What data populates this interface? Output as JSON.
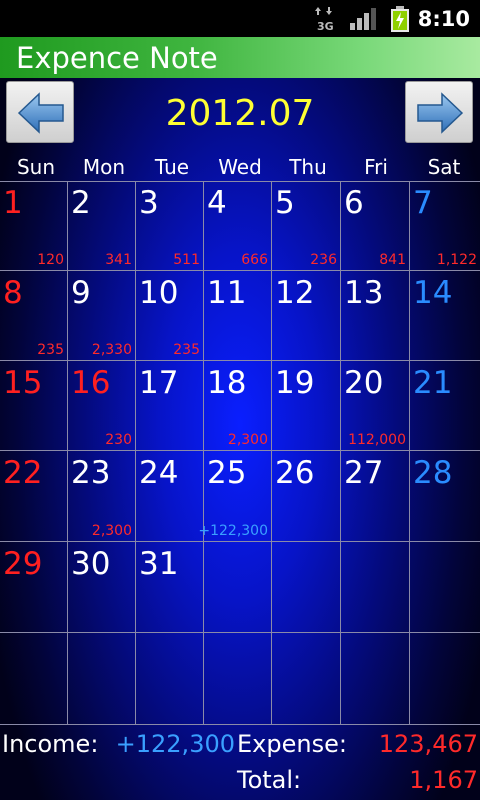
{
  "status_bar": {
    "network": "3G",
    "time": "8:10"
  },
  "app": {
    "title": "Expence Note"
  },
  "calendar": {
    "month": "2012.07",
    "weekdays": [
      "Sun",
      "Mon",
      "Tue",
      "Wed",
      "Thu",
      "Fri",
      "Sat"
    ],
    "rows": [
      [
        {
          "d": "1",
          "a": "120"
        },
        {
          "d": "2",
          "a": "341"
        },
        {
          "d": "3",
          "a": "511"
        },
        {
          "d": "4",
          "a": "666"
        },
        {
          "d": "5",
          "a": "236"
        },
        {
          "d": "6",
          "a": "841"
        },
        {
          "d": "7",
          "a": "1,122"
        }
      ],
      [
        {
          "d": "8",
          "a": "235"
        },
        {
          "d": "9",
          "a": "2,330"
        },
        {
          "d": "10",
          "a": "235"
        },
        {
          "d": "11",
          "a": ""
        },
        {
          "d": "12",
          "a": ""
        },
        {
          "d": "13",
          "a": ""
        },
        {
          "d": "14",
          "a": ""
        }
      ],
      [
        {
          "d": "15",
          "a": ""
        },
        {
          "d": "16",
          "a": "230"
        },
        {
          "d": "17",
          "a": ""
        },
        {
          "d": "18",
          "a": "2,300"
        },
        {
          "d": "19",
          "a": ""
        },
        {
          "d": "20",
          "a": "112,000"
        },
        {
          "d": "21",
          "a": ""
        }
      ],
      [
        {
          "d": "22",
          "a": ""
        },
        {
          "d": "23",
          "a": "2,300"
        },
        {
          "d": "24",
          "a": ""
        },
        {
          "d": "25",
          "a": "+122,300",
          "income": true
        },
        {
          "d": "26",
          "a": ""
        },
        {
          "d": "27",
          "a": ""
        },
        {
          "d": "28",
          "a": ""
        }
      ],
      [
        {
          "d": "29",
          "a": ""
        },
        {
          "d": "30",
          "a": ""
        },
        {
          "d": "31",
          "a": ""
        },
        {
          "d": "",
          "a": ""
        },
        {
          "d": "",
          "a": ""
        },
        {
          "d": "",
          "a": ""
        },
        {
          "d": "",
          "a": ""
        }
      ],
      [
        {
          "d": "",
          "a": ""
        },
        {
          "d": "",
          "a": ""
        },
        {
          "d": "",
          "a": ""
        },
        {
          "d": "",
          "a": ""
        },
        {
          "d": "",
          "a": ""
        },
        {
          "d": "",
          "a": ""
        },
        {
          "d": "",
          "a": ""
        }
      ]
    ],
    "holidays": [
      "16"
    ]
  },
  "summary": {
    "income_label": "Income:",
    "income_value": "+122,300",
    "expense_label": "Expense:",
    "expense_value": "123,467",
    "total_label": "Total:",
    "total_value": "1,167"
  },
  "colors": {
    "income": "#3aa0ff",
    "expense": "#ff2a2a",
    "sunday": "#ff2020",
    "saturday": "#2a8cff",
    "month": "#ffff33"
  }
}
